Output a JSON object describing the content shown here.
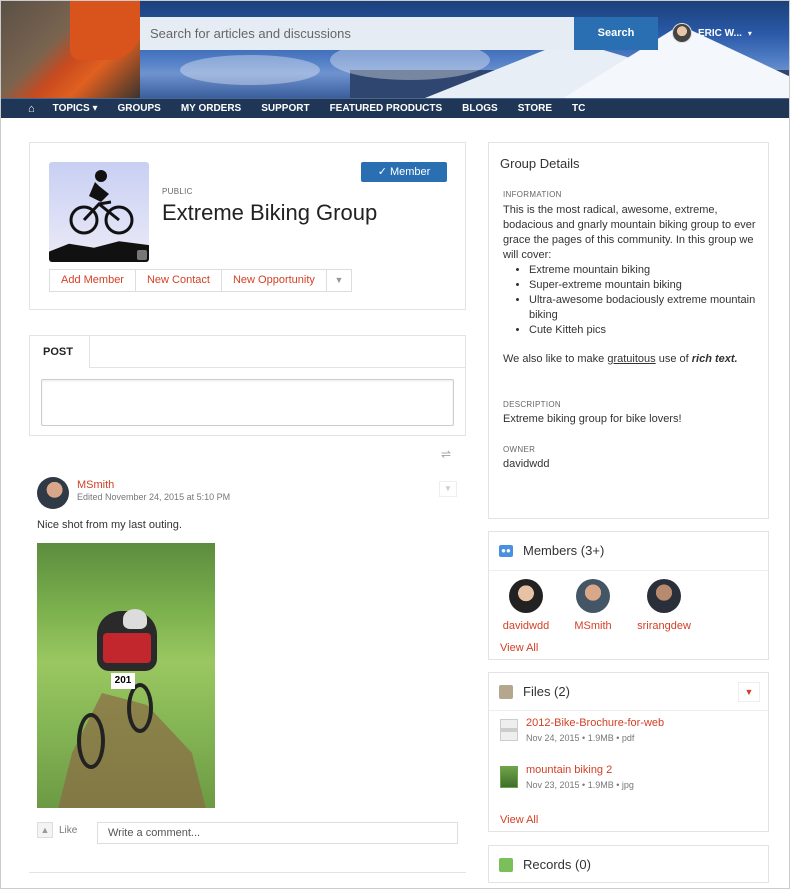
{
  "header": {
    "search_placeholder": "Search for articles and discussions",
    "search_button": "Search",
    "user_name": "ERIC W...",
    "user_caret": "▾"
  },
  "nav": {
    "home_icon": "⌂",
    "items": [
      "TOPICS ▾",
      "GROUPS",
      "MY ORDERS",
      "SUPPORT",
      "FEATURED PRODUCTS",
      "BLOGS",
      "STORE",
      "TC"
    ]
  },
  "group": {
    "visibility": "PUBLIC",
    "title": "Extreme Biking Group",
    "member_button": "✓  Member",
    "actions": [
      "Add Member",
      "New Contact",
      "New Opportunity"
    ],
    "actions_more": "▼"
  },
  "publisher": {
    "tab": "POST"
  },
  "feed": {
    "sort_icon": "⇌",
    "item": {
      "author": "MSmith",
      "meta": "Edited November 24, 2015 at 5:10 PM",
      "menu_icon": "▼",
      "text": "Nice shot from my last outing.",
      "photo_number": "201",
      "like_icon": "👍",
      "like_label": "Like",
      "comment_placeholder": "Write a comment..."
    }
  },
  "details": {
    "heading": "Group Details",
    "info_label": "INFORMATION",
    "info_text": "This is the most radical, awesome, extreme, bodacious and gnarly mountain biking group to ever grace the pages of this community. In this group we will cover:",
    "bullets": [
      "Extreme mountain biking",
      "Super-extreme mountain biking",
      "Ultra-awesome bodaciously extreme mountain biking",
      "Cute Kitteh pics"
    ],
    "rich_pre": "We also like to make ",
    "rich_link": "gratuitous",
    "rich_mid": " use of ",
    "rich_bold": "rich text.",
    "desc_label": "DESCRIPTION",
    "desc_text": "Extreme biking group for bike lovers!",
    "owner_label": "OWNER",
    "owner_text": "davidwdd"
  },
  "members": {
    "heading": "Members (3+)",
    "list": [
      {
        "name": "davidwdd"
      },
      {
        "name": "MSmith"
      },
      {
        "name": "srirangdew"
      }
    ],
    "view_all": "View All"
  },
  "files": {
    "heading": "Files (2)",
    "menu_icon": "▼",
    "list": [
      {
        "name": "2012-Bike-Brochure-for-web",
        "meta": "Nov 24, 2015 • 1.9MB • pdf"
      },
      {
        "name": "mountain biking 2",
        "meta": "Nov 23, 2015 • 1.9MB • jpg"
      }
    ],
    "view_all": "View All"
  },
  "records": {
    "heading": "Records (0)"
  }
}
